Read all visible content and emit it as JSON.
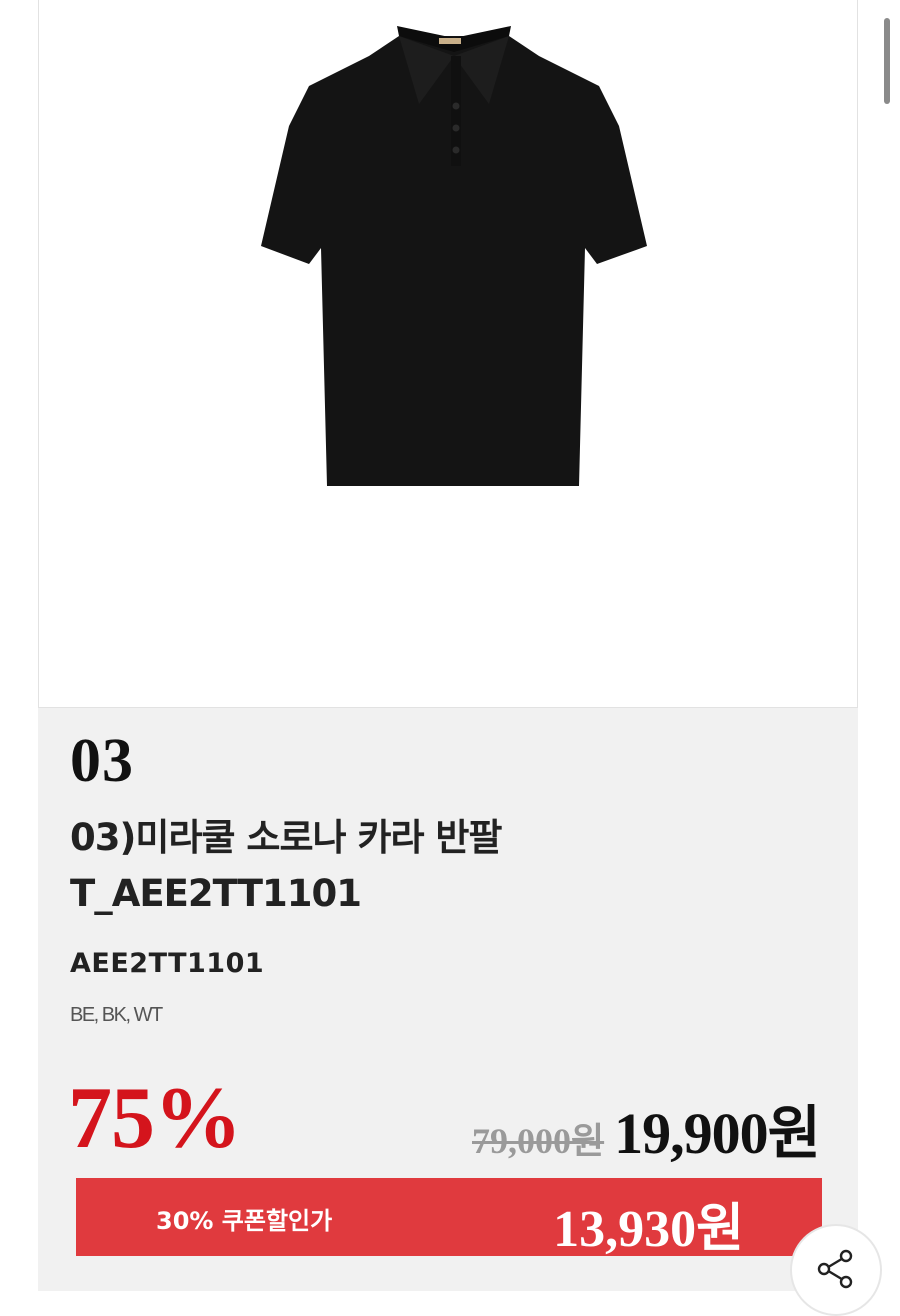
{
  "product": {
    "image_alt": "black short-sleeve collar shirt",
    "rank": "03",
    "title": "03)미라쿨 소로나 카라 반팔 T_AEE2TT1101",
    "code": "AEE2TT1101",
    "colors": "BE, BK, WT"
  },
  "pricing": {
    "discount_rate": "75%",
    "original_price": "79,000원",
    "sale_price": "19,900원",
    "coupon_label": "30% 쿠폰할인가",
    "coupon_price": "13,930원"
  },
  "colors": {
    "accent_red": "#d4141c",
    "coupon_bar": "#e03a3e",
    "info_background": "#f1f1f1"
  },
  "icons": {
    "share": "share-icon"
  }
}
